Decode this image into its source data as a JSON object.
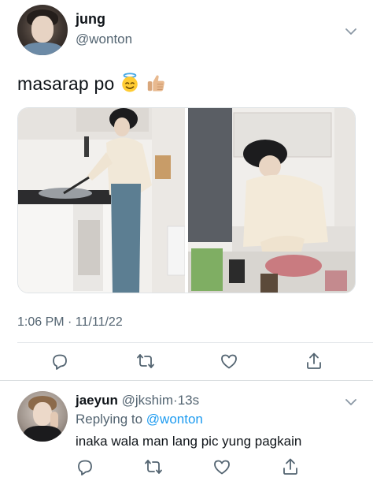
{
  "tweet": {
    "author_name": "jung",
    "author_handle": "@wonton",
    "text": "masarap po",
    "emojis": [
      "smiling-face-with-halo-icon",
      "thumbs-up-icon"
    ],
    "timestamp": "1:06 PM · 11/11/22",
    "media_count": 2
  },
  "reply": {
    "author_name": "jaeyun",
    "author_handle": "@jkshim",
    "separator": "·",
    "time": "13s",
    "replying_prefix": "Replying to",
    "replying_to": "@wonton",
    "text": "inaka wala man lang pic yung pagkain"
  },
  "actions": [
    "reply-icon",
    "retweet-icon",
    "like-icon",
    "share-icon"
  ],
  "colors": {
    "text": "#0f1419",
    "muted": "#536471",
    "link": "#1d9bf0",
    "border": "#e3e7ea"
  }
}
